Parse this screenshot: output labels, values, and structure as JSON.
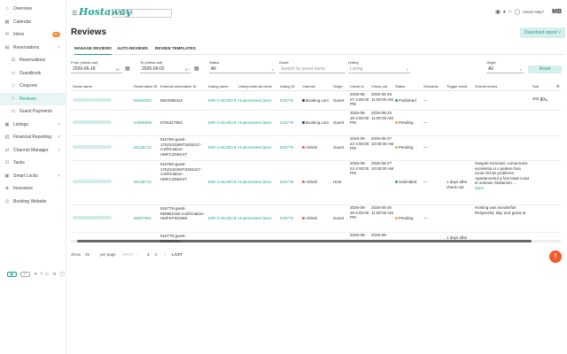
{
  "sidebar": {
    "items": [
      {
        "label": "Overview",
        "icon": "home-icon",
        "sub": false
      },
      {
        "label": "Calendar",
        "icon": "calendar-icon",
        "sub": false
      },
      {
        "label": "Inbox",
        "icon": "inbox-icon",
        "sub": false,
        "badge": "22"
      },
      {
        "label": "Reservations",
        "icon": "reservations-icon",
        "sub": false,
        "chev": "^"
      },
      {
        "label": "Reservations",
        "icon": "list-icon",
        "sub": true
      },
      {
        "label": "Guestbook",
        "icon": "book-icon",
        "sub": true
      },
      {
        "label": "Coupons",
        "icon": "coupon-icon",
        "sub": true
      },
      {
        "label": "Reviews",
        "icon": "star-icon",
        "sub": true,
        "active": true
      },
      {
        "label": "Guest Payments",
        "icon": "payment-icon",
        "sub": true
      },
      {
        "label": "Listings",
        "icon": "listings-icon",
        "sub": false,
        "chev": "v"
      },
      {
        "label": "Financial Reporting",
        "icon": "finance-icon",
        "sub": false,
        "chev": "v"
      },
      {
        "label": "Channel Manager",
        "icon": "channel-icon",
        "sub": false,
        "chev": "v"
      },
      {
        "label": "Tasks",
        "icon": "tasks-icon",
        "sub": false
      },
      {
        "label": "Smart Locks",
        "icon": "lock-icon",
        "sub": false,
        "chev": "v"
      },
      {
        "label": "Insurance",
        "icon": "insurance-icon",
        "sub": false
      },
      {
        "label": "Booking Website",
        "icon": "website-icon",
        "sub": false
      }
    ]
  },
  "header": {
    "logo": "Hostaway",
    "search_placeholder": "Search",
    "help": "Need Help?",
    "initials": "MB"
  },
  "page": {
    "title": "Reviews",
    "download": "Download report"
  },
  "tabs": [
    "MANAGE REVIEWS",
    "AUTO-REVIEWS",
    "REVIEW TEMPLATES"
  ],
  "filters": {
    "from_label": "From (check-out)",
    "from_value": "2026-06-18",
    "to_label": "To (check-out)",
    "to_value": "2026-09-02",
    "status_label": "Status",
    "status_value": "All",
    "guest_label": "Guest",
    "guest_placeholder": "Search by guest name",
    "listing_label": "Listing",
    "listing_placeholder": "Listing",
    "origin_label": "Origin",
    "origin_value": "All",
    "reset": "Reset"
  },
  "table": {
    "headers": [
      "Guest name",
      "Reservation ID",
      "External reservation ID",
      "Listing name",
      "Listing external name",
      "Listing ID",
      "Channel",
      "Origin",
      "Check-in",
      "Check-out",
      "Status",
      "Schedule",
      "Trigger event",
      "Overall review",
      "Sub"
    ],
    "rows": [
      {
        "res": "62064003",
        "ext": "5943395423",
        "listing": "IMR-CAB,803 B",
        "lext": "HuatoSuitesCiareo",
        "lid": "518779",
        "channel": "Booking.com",
        "chcolor": "#1b3a8c",
        "origin": "Guest",
        "checkin": "2026-06-27 4:00:00 PM",
        "checkout": "2026-06-29 11:00:00 AM",
        "status": "Published",
        "stcolor": "#2e9e5b",
        "schedule": "—",
        "trigger": "",
        "review": "",
        "sub": "202 8/1"
      },
      {
        "res": "64956808",
        "ext": "5791617582",
        "listing": "IMR-CAB,803 B",
        "lext": "HuatoSuitesCiareo",
        "lid": "518779",
        "channel": "Booking.com",
        "chcolor": "#1b3a8c",
        "origin": "Guest",
        "checkin": "2026-06-19 4:00:00 PM",
        "checkout": "2026-06-23 11:00:00 AM",
        "status": "Pending",
        "stcolor": "#f2a72c",
        "schedule": "—",
        "trigger": "",
        "review": "",
        "sub": ""
      },
      {
        "res": "65136712",
        "ext": "518780-guest-175234346973493417-confirmation-HMFCZD6KXT",
        "listing": "IMR-CAB,803 B",
        "lext": "HuatoSuitesCiareo",
        "lid": "518779",
        "channel": "Airbnb",
        "chcolor": "#f0595e",
        "origin": "Guest",
        "checkin": "2026-06-24 4:00:00 PM",
        "checkout": "2026-06-27 10:00:00 AM",
        "status": "Pending",
        "stcolor": "#f2a72c",
        "schedule": "—",
        "trigger": "",
        "review": "",
        "sub": ""
      },
      {
        "res": "65138712",
        "ext": "518780-guest-175234346973493417-confirmation-HMFCZD6KXT",
        "listing": "IMR-CAB,803 B",
        "lext": "HuatoSuitesCiareo",
        "lid": "518779",
        "channel": "Airbnb",
        "chcolor": "#f0595e",
        "origin": "Host",
        "checkin": "2026-06-24 4:00:00 PM",
        "checkout": "2026-06-27 10:00:00 AM",
        "status": "Submitted",
        "stcolor": "#2e9e5b",
        "schedule": "—",
        "trigger": "1 days after check-out",
        "review": "Oaspeti minunati, comunicare excelenta si o pedere fara niciun fel de probleme. Apartamentul a fost lasat curat si ordonat. Multumim ...",
        "more": "More",
        "sub": ""
      },
      {
        "res": "66507951",
        "ext": "518779-guest-550962165-confirmation-HMFKP3S2MS",
        "listing": "IMR-CAB,803 B",
        "lext": "HuatoSuitesCiareo",
        "lid": "518779",
        "channel": "Airbnb",
        "chcolor": "#f0595e",
        "origin": "Guest",
        "checkin": "2026-06-29 6:00:00 PM",
        "checkout": "2026-06-30 11:00:00 AM",
        "status": "Pending",
        "stcolor": "#f2a72c",
        "schedule": "—",
        "trigger": "",
        "review": "Hosting was wonderful! Respectful, tidy, and great at",
        "sub": ""
      },
      {
        "res": "",
        "ext": "518779-guest-550962165-",
        "listing": "",
        "lext": "",
        "lid": "",
        "channel": "",
        "chcolor": "#fff",
        "origin": "",
        "checkin": "2026-06-",
        "checkout": "2026-06-",
        "status": "",
        "stcolor": "#fff",
        "schedule": "",
        "trigger": "1 days after",
        "review": "",
        "sub": ""
      }
    ]
  },
  "pager": {
    "show_label": "Show",
    "show_value": "25",
    "per_page": "per page",
    "first": "FIRST",
    "prev": "‹",
    "p1": "1",
    "p2": "2",
    "next": "›",
    "last": "LAST"
  },
  "fab": "!"
}
